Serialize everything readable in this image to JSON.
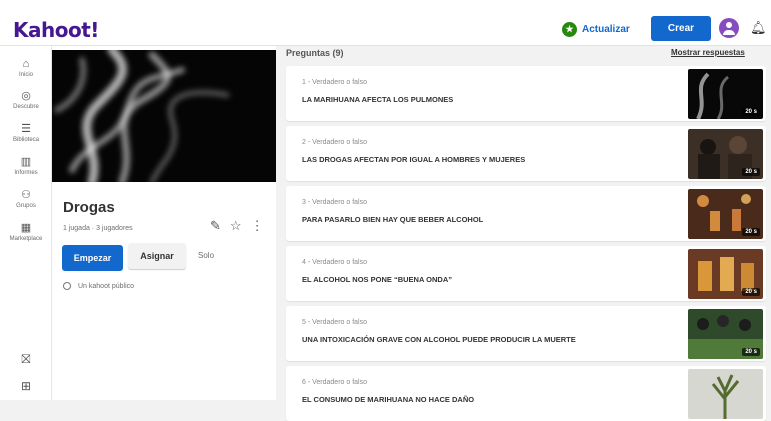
{
  "header": {
    "logo": "Kahoot!",
    "upgrade_label": "Actualizar",
    "create_label": "Crear"
  },
  "sidebar": {
    "items": [
      {
        "label": "Inicio",
        "icon": "⌂"
      },
      {
        "label": "Descubre",
        "icon": "◎"
      },
      {
        "label": "Biblioteca",
        "icon": "☰"
      },
      {
        "label": "Informes",
        "icon": "▥"
      },
      {
        "label": "Grupos",
        "icon": "⚇"
      },
      {
        "label": "Marketplace",
        "icon": "▦"
      }
    ],
    "bottom_icons": [
      "gift-icon",
      "apps-icon"
    ]
  },
  "kahoot": {
    "title": "Drogas",
    "meta": "1 jugada · 3 jugadores",
    "start_label": "Empezar",
    "assign_label": "Asignar",
    "solo_label": "Solo",
    "visibility": "Un kahoot público"
  },
  "questions": {
    "header": "Preguntas (9)",
    "show_answers": "Mostrar respuestas",
    "items": [
      {
        "type": "1 - Verdadero o falso",
        "text": "LA MARIHUANA AFECTA LOS PULMONES",
        "time": "20 s"
      },
      {
        "type": "2 - Verdadero o falso",
        "text": "LAS DROGAS AFECTAN POR IGUAL A HOMBRES Y MUJERES",
        "time": "20 s"
      },
      {
        "type": "3 - Verdadero o falso",
        "text": "PARA PASARLO BIEN HAY QUE BEBER ALCOHOL",
        "time": "20 s"
      },
      {
        "type": "4 - Verdadero o falso",
        "text": "EL ALCOHOL NOS PONE “BUENA ONDA”",
        "time": "20 s"
      },
      {
        "type": "5 - Verdadero o falso",
        "text": "UNA INTOXICACIÓN GRAVE CON ALCOHOL PUEDE PRODUCIR LA MUERTE",
        "time": "20 s"
      },
      {
        "type": "6 - Verdadero o falso",
        "text": "EL CONSUMO DE MARIHUANA NO HACE DAÑO",
        "time": ""
      }
    ]
  },
  "colors": {
    "brand": "#46178f",
    "primary": "#1368ce",
    "success": "#26890c"
  }
}
